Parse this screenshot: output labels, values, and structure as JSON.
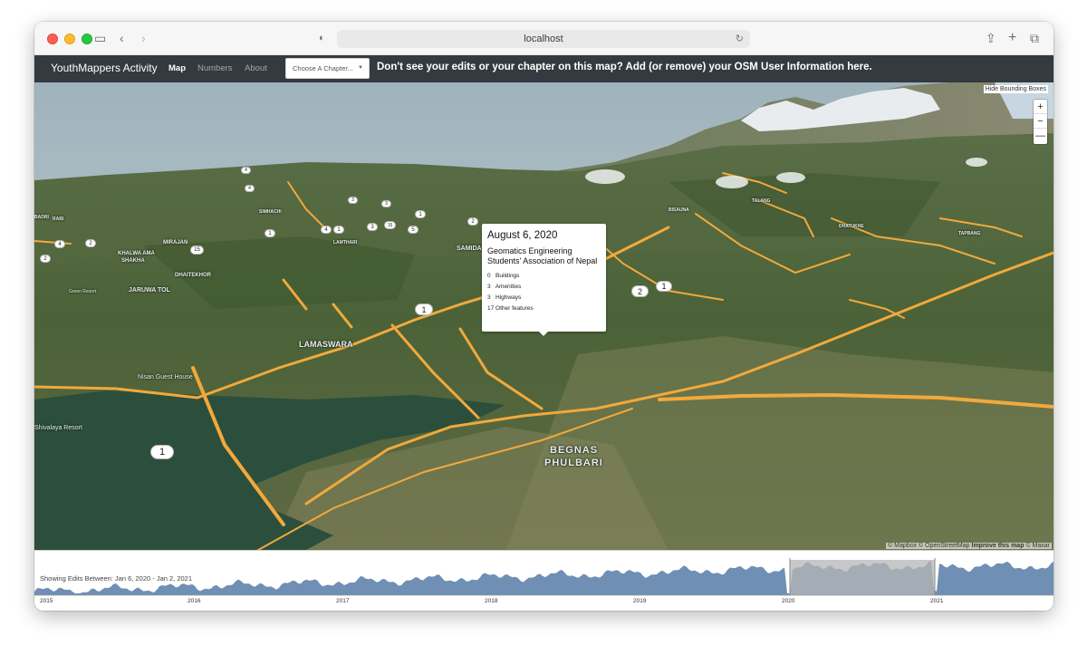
{
  "browser": {
    "url": "localhost"
  },
  "navbar": {
    "brand": "YouthMappers Activity",
    "links": [
      {
        "label": "Map",
        "active": true
      },
      {
        "label": "Numbers",
        "active": false
      },
      {
        "label": "About",
        "active": false
      }
    ],
    "chapter_select": "Choose A Chapter...",
    "message": "Don't see your edits or your chapter on this map? Add (or remove) your OSM User Information here."
  },
  "map": {
    "bbox_button": "Hide Bounding Boxes",
    "zoom_in": "+",
    "zoom_out": "−",
    "compass": "—",
    "place_labels": {
      "lamaswara": "LAMASWARA",
      "begnas": "BEGNAS",
      "phulbari": "PHULBARI",
      "jaruwa_tol": "JARUWA TOL",
      "dhaitekhor": "DHAITEKHOR",
      "khalwa_ama": "KHALWA AMA",
      "shakha": "SHAKHA",
      "mirajan": "MIRAJAN",
      "samida_tol": "SAMIDA TOL",
      "bisauna": "BISAUNA",
      "nisan_guest_house": "Nisan Guest House",
      "shivalaya_resort": "Shivalaya Resort",
      "green_resort": "Green Resort",
      "simhachi": "SIMHACHI",
      "dhatukhe": "DHATUKHE",
      "talang": "TALANG",
      "badri": "BADRI",
      "rabi": "RABI",
      "tapbang": "TAPBANG",
      "lamthari": "LAMTHARI"
    },
    "markers": [
      "1",
      "1",
      "2",
      "1",
      "15",
      "2",
      "2",
      "4",
      "1",
      "2",
      "3",
      "4",
      "15",
      "4",
      "1",
      "3",
      "5",
      "1",
      "4",
      "3"
    ],
    "popup": {
      "date": "August 6, 2020",
      "chapter": "Geomatics Engineering Students' Association of Nepal",
      "stats": [
        {
          "count": "0",
          "label": "Buildings"
        },
        {
          "count": "3",
          "label": "Amenities"
        },
        {
          "count": "3",
          "label": "Highways"
        },
        {
          "count": "17",
          "label": "Other features"
        }
      ]
    },
    "attribution": {
      "text1": "© Mapbox © OpenStreetMap",
      "link": "Improve this map",
      "text2": "© Maxar"
    }
  },
  "timeline": {
    "range_label": "Showing Edits Between: Jan 6, 2020 - Jan 2, 2021",
    "years": [
      "2015",
      "2016",
      "2017",
      "2018",
      "2019",
      "2020",
      "2021"
    ],
    "selection": {
      "start": "Jan 6, 2020",
      "end": "Jan 2, 2021"
    },
    "colors": {
      "area": "#6f8fb4",
      "selection": "#b5b5b5"
    }
  },
  "colors": {
    "navbar": "#343a40",
    "highway": "#f2a93b",
    "lake": "#2b4f3c"
  }
}
